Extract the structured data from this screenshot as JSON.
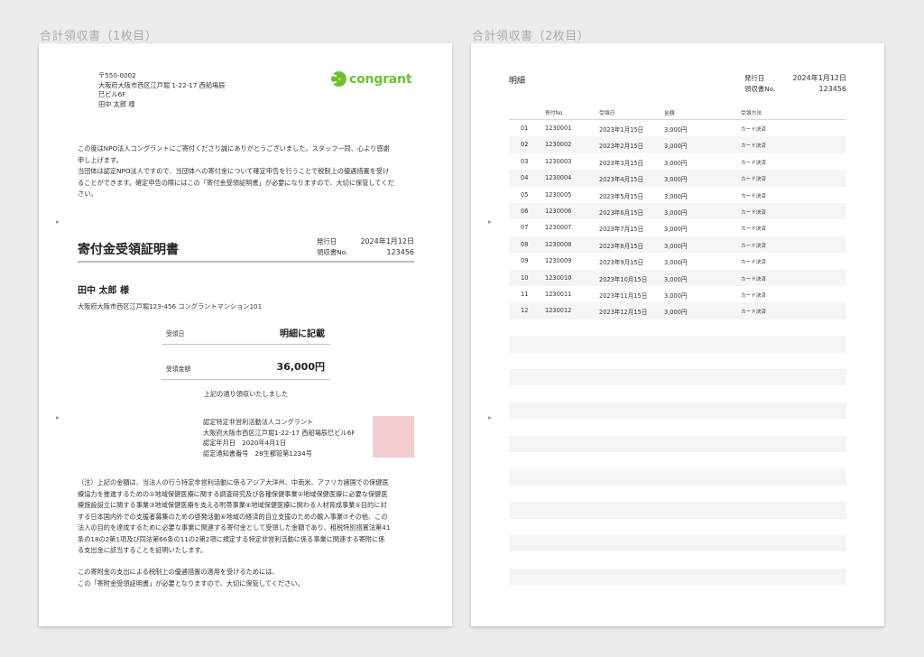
{
  "captions": {
    "page1": "合計領収書（1枚目）",
    "page2": "合計領収書（2枚目）"
  },
  "page1": {
    "address_block": [
      "〒550-0002",
      "大阪府大阪市西区江戸堀 1-22-17 西船場辰",
      "巳ビル6F",
      "田中 太郎 様"
    ],
    "logo_text": "congrant",
    "intro_lines": [
      "この度はNPO法人コングラントにご寄付くださり誠にありがとうございました。スタッフ一同、心より感謝",
      "申し上げます。",
      "当団体は認定NPO法人ですので、当団体への寄付金について確定申告を行うことで税制上の優遇措置を受け",
      "ることができます。確定申告の際にはこの「寄付金受領証明書」が必要になりますので、大切に保管してくだ",
      "さい。"
    ],
    "certificate": {
      "title": "寄付金受領証明書",
      "issue_date_label": "発行日",
      "issue_date": "2024年1月12日",
      "receipt_no_label": "領収書No.",
      "receipt_no": "123456"
    },
    "recipient": {
      "name": "田中 太郎 様",
      "address": "大阪府大阪市西区江戸堀123-456 コングラントマンション101"
    },
    "received_date_label": "受領日",
    "received_date_value": "明細に記載",
    "amount_label": "受領金額",
    "amount_value": "36,000円",
    "received_note": "上記の通り領収いたしました",
    "org_lines": [
      "認定特定非営利活動法人コングラント",
      "大阪府大阪市西区江戸堀1-22-17 西船場辰巳ビル6F",
      "認定年月日　2020年4月1日",
      "認定通知書番号　28生都管第1234号"
    ],
    "note_lines": [
      "（注）上記の金額は、当法人の行う特定非営利活動に係るアジア大洋州、中南米、アフリカ諸国での保健医",
      "療協力を推進するための①地域保健医療に関する調査研究及び各種保健事業②地域保健医療に必要な保健医",
      "療施設設立に関する事業③地域保健医療を支える附帯事業④地域保健医療に関わる人材育成事業⑤目的に対",
      "する日本国内外での支援者募集のための啓発活動⑥地域の経済的自立支援のための輸入事業⑦その他、この",
      "法人の目的を達成するために必要な事業に関連する寄付金として受領した金額であり、租税特別措置法第41",
      "条の18の2第1項及び同法第66条の11の2第2項に規定する特定非営利活動に係る事業に関連する寄附に係",
      "る支出金に該当することを証明いたします。"
    ],
    "closing_lines": [
      "この寄附金の支出による税制上の優遇措置の適用を受けるためには、",
      "この「寄附金受領証明書」が必要となりますので、大切に保管してください。"
    ]
  },
  "page2": {
    "title": "明細",
    "issue_date_label": "発行日",
    "issue_date": "2024年1月12日",
    "receipt_no_label": "領収書No.",
    "receipt_no": "123456",
    "columns": [
      "寄付No.",
      "受領日",
      "金額",
      "受領方法"
    ],
    "rows": [
      [
        "01",
        "1230001",
        "2023年1月15日",
        "3,000円",
        "カード決済"
      ],
      [
        "02",
        "1230002",
        "2023年2月15日",
        "3,000円",
        "カード決済"
      ],
      [
        "03",
        "1230003",
        "2023年3月15日",
        "3,000円",
        "カード決済"
      ],
      [
        "04",
        "1230004",
        "2023年4月15日",
        "3,000円",
        "カード決済"
      ],
      [
        "05",
        "1230005",
        "2023年5月15日",
        "3,000円",
        "カード決済"
      ],
      [
        "06",
        "1230006",
        "2023年6月15日",
        "3,000円",
        "カード決済"
      ],
      [
        "07",
        "1230007",
        "2023年7月15日",
        "3,000円",
        "カード決済"
      ],
      [
        "08",
        "1230008",
        "2023年8月15日",
        "3,000円",
        "カード決済"
      ],
      [
        "09",
        "1230009",
        "2023年9月15日",
        "3,000円",
        "カード決済"
      ],
      [
        "10",
        "1230010",
        "2023年10月15日",
        "3,000円",
        "カード決済"
      ],
      [
        "11",
        "1230011",
        "2023年11月15日",
        "3,000円",
        "カード決済"
      ],
      [
        "12",
        "1230012",
        "2023年12月15日",
        "3,000円",
        "カード決済"
      ]
    ],
    "empty_rows": 16
  },
  "colors": {
    "brand_green": "#6cc133",
    "stamp_pink": "#f2cdd2",
    "row_stripe": "#f5f5f6",
    "background": "#ececed"
  },
  "icons": {
    "logo": "congrant-logo-icon",
    "page_marker": "triangle-marker-icon"
  }
}
